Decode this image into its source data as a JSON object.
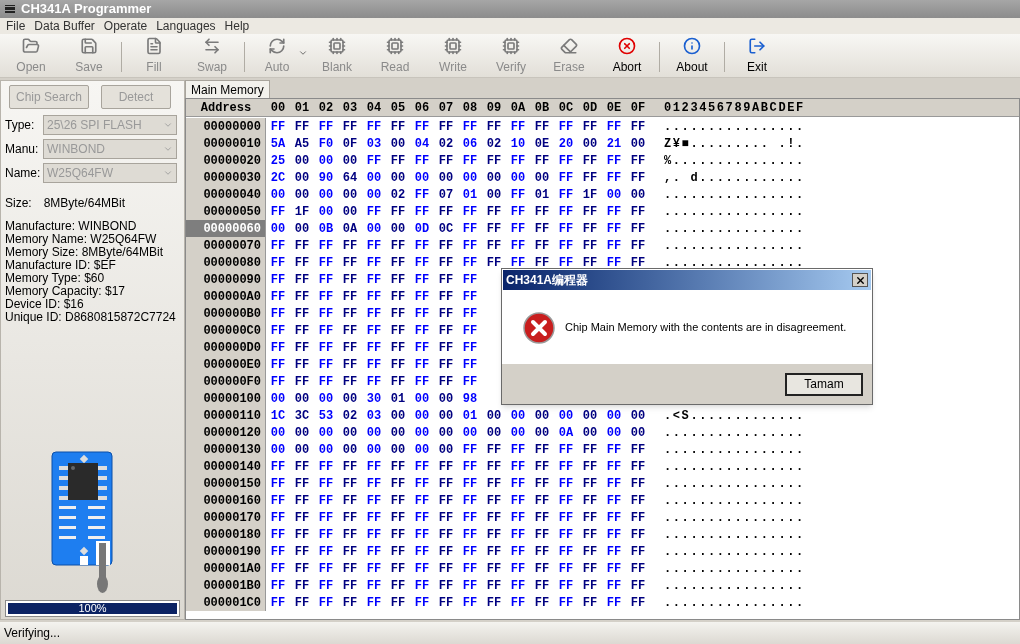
{
  "window": {
    "title": "CH341A Programmer"
  },
  "menu": [
    "File",
    "Data Buffer",
    "Operate",
    "Languages",
    "Help"
  ],
  "toolbar": {
    "groups": [
      [
        {
          "label": "Open",
          "kind": "button",
          "disabled": true
        },
        {
          "label": "Save",
          "kind": "button",
          "disabled": true
        }
      ],
      [
        {
          "label": "Fill",
          "kind": "button",
          "disabled": true
        },
        {
          "label": "Swap",
          "kind": "button",
          "disabled": true
        }
      ],
      [
        {
          "label": "Auto",
          "kind": "split",
          "disabled": true
        },
        {
          "label": "Blank",
          "kind": "button",
          "disabled": true
        },
        {
          "label": "Read",
          "kind": "button",
          "disabled": true
        },
        {
          "label": "Write",
          "kind": "button",
          "disabled": true
        },
        {
          "label": "Verify",
          "kind": "button",
          "disabled": true
        },
        {
          "label": "Erase",
          "kind": "button",
          "disabled": true
        },
        {
          "label": "Abort",
          "kind": "button",
          "disabled": false
        }
      ],
      [
        {
          "label": "About",
          "kind": "button",
          "disabled": false
        }
      ],
      [
        {
          "label": "Exit",
          "kind": "button",
          "disabled": false
        }
      ]
    ]
  },
  "left_panel": {
    "buttons": [
      {
        "label": "Chip Search",
        "disabled": true
      },
      {
        "label": "Detect",
        "disabled": true
      }
    ],
    "fields": [
      {
        "label": "Type:",
        "value": "25\\26 SPI FLASH",
        "disabled": true
      },
      {
        "label": "Manu:",
        "value": "WINBOND",
        "disabled": true
      },
      {
        "label": "Name:",
        "value": "W25Q64FW",
        "disabled": true
      }
    ],
    "size": {
      "label": "Size:",
      "value": "8MByte/64MBit"
    },
    "info": [
      "Manufacture: WINBOND",
      "Memory Name: W25Q64FW",
      "Memory Size: 8MByte/64MBit",
      "Manufacture ID: $EF",
      "Memory Type: $60",
      "Memory Capacity: $17",
      "Device ID: $16",
      "Unique ID: D8680815872C7724"
    ],
    "progress": {
      "level": 1,
      "text": "100%"
    }
  },
  "tabs": [
    {
      "label": "Main Memory",
      "selected": true
    }
  ],
  "hex": {
    "address_header": "Address",
    "columns": [
      "00",
      "01",
      "02",
      "03",
      "04",
      "05",
      "06",
      "07",
      "08",
      "09",
      "0A",
      "0B",
      "0C",
      "0D",
      "0E",
      "0F"
    ],
    "ascii_header": "0123456789ABCDEF",
    "rows": [
      {
        "address": "00000000",
        "bytes": "FF FF FF FF FF FF FF FF FF FF FF FF FF FF FF FF",
        "ascii": "................",
        "selected": false
      },
      {
        "address": "00000010",
        "bytes": "5A A5 F0 0F 03 00 04 02 06 02 10 0E 20 00 21 00",
        "ascii": "Z¥■......... .!.",
        "selected": false
      },
      {
        "address": "00000020",
        "bytes": "25 00 00 00 FF FF FF FF FF FF FF FF FF FF FF FF",
        "ascii": "%...............",
        "selected": false
      },
      {
        "address": "00000030",
        "bytes": "2C 00 90 64 00 00 00 00 00 00 00 00 FF FF FF FF",
        "ascii": ",. d............",
        "selected": false
      },
      {
        "address": "00000040",
        "bytes": "00 00 00 00 00 02 FF 07 01 00 FF 01 FF 1F 00 00",
        "ascii": "................",
        "selected": false
      },
      {
        "address": "00000050",
        "bytes": "FF 1F 00 00 FF FF FF FF FF FF FF FF FF FF FF FF",
        "ascii": "................",
        "selected": false
      },
      {
        "address": "00000060",
        "bytes": "00 00 0B 0A 00 00 0D 0C FF FF FF FF FF FF FF FF",
        "ascii": "................",
        "selected": true
      },
      {
        "address": "00000070",
        "bytes": "FF FF FF FF FF FF FF FF FF FF FF FF FF FF FF FF",
        "ascii": "................",
        "selected": false
      },
      {
        "address": "00000080",
        "bytes": "FF FF FF FF FF FF FF FF FF FF FF FF FF FF FF FF",
        "ascii": "................",
        "selected": false
      },
      {
        "address": "00000090",
        "bytes": "FF FF FF FF FF FF FF FF FF",
        "selected": false
      },
      {
        "address": "000000A0",
        "bytes": "FF FF FF FF FF FF FF FF FF",
        "selected": false
      },
      {
        "address": "000000B0",
        "bytes": "FF FF FF FF FF FF FF FF FF",
        "selected": false
      },
      {
        "address": "000000C0",
        "bytes": "FF FF FF FF FF FF FF FF FF",
        "selected": false
      },
      {
        "address": "000000D0",
        "bytes": "FF FF FF FF FF FF FF FF FF",
        "selected": false
      },
      {
        "address": "000000E0",
        "bytes": "FF FF FF FF FF FF FF FF FF",
        "selected": false
      },
      {
        "address": "000000F0",
        "bytes": "FF FF FF FF FF FF FF FF FF",
        "selected": false
      },
      {
        "address": "00000100",
        "bytes": "00 00 00 00 30 01 00 00 98",
        "selected": false
      },
      {
        "address": "00000110",
        "bytes": "1C 3C 53 02 03 00 00 00 01 00 00 00 00 00 00 00",
        "ascii": ".<S.............",
        "selected": false
      },
      {
        "address": "00000120",
        "bytes": "00 00 00 00 00 00 00 00 00 00 00 00 0A 00 00 00",
        "ascii": "................",
        "selected": false
      },
      {
        "address": "00000130",
        "bytes": "00 00 00 00 00 00 00 00 FF FF FF FF FF FF FF FF",
        "ascii": "................",
        "selected": false
      },
      {
        "address": "00000140",
        "bytes": "FF FF FF FF FF FF FF FF FF FF FF FF FF FF FF FF",
        "ascii": "................",
        "selected": false
      },
      {
        "address": "00000150",
        "bytes": "FF FF FF FF FF FF FF FF FF FF FF FF FF FF FF FF",
        "ascii": "................",
        "selected": false
      },
      {
        "address": "00000160",
        "bytes": "FF FF FF FF FF FF FF FF FF FF FF FF FF FF FF FF",
        "ascii": "................",
        "selected": false
      },
      {
        "address": "00000170",
        "bytes": "FF FF FF FF FF FF FF FF FF FF FF FF FF FF FF FF",
        "ascii": "................",
        "selected": false
      },
      {
        "address": "00000180",
        "bytes": "FF FF FF FF FF FF FF FF FF FF FF FF FF FF FF FF",
        "ascii": "................",
        "selected": false
      },
      {
        "address": "00000190",
        "bytes": "FF FF FF FF FF FF FF FF FF FF FF FF FF FF FF FF",
        "ascii": "................",
        "selected": false
      },
      {
        "address": "000001A0",
        "bytes": "FF FF FF FF FF FF FF FF FF FF FF FF FF FF FF FF",
        "ascii": "................",
        "selected": false
      },
      {
        "address": "000001B0",
        "bytes": "FF FF FF FF FF FF FF FF FF FF FF FF FF FF FF FF",
        "ascii": "................",
        "selected": false
      },
      {
        "address": "000001C0",
        "bytes": "FF FF FF FF FF FF FF FF FF FF FF FF FF FF FF FF",
        "ascii": "................",
        "selected": false
      }
    ]
  },
  "dialog": {
    "title": "CH341A编程器",
    "message": "Chip Main Memory with the contents are in disagreement.",
    "button": "Tamam"
  },
  "status_bar": {
    "text": "Verifying..."
  }
}
